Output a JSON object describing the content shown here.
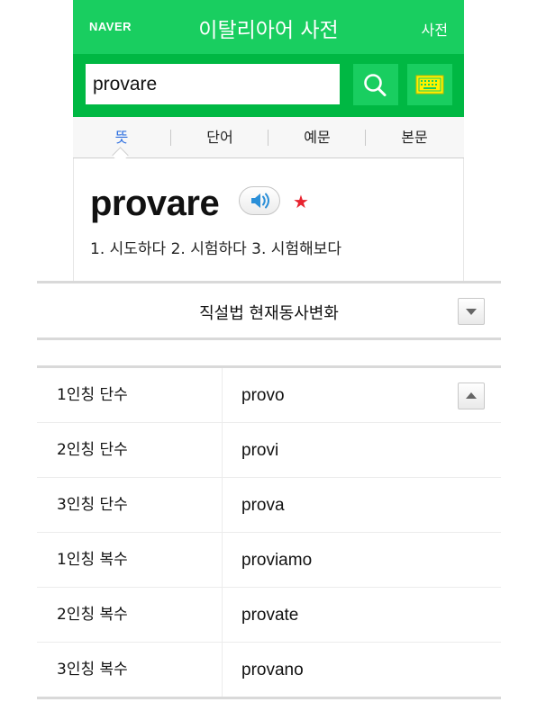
{
  "header": {
    "logo": "NAVER",
    "title": "이탈리아어 사전",
    "link": "사전"
  },
  "search": {
    "value": "provare"
  },
  "icons": {
    "search": "search-icon",
    "keyboard": "keyboard-icon",
    "speaker": "speaker-icon",
    "star": "star-icon",
    "dropdown": "chevron-down-icon",
    "collapse": "chevron-up-icon"
  },
  "colors": {
    "header_green": "#19ce60",
    "search_green": "#00b843",
    "active_tab": "#2f70e0",
    "star_red": "#e8232f"
  },
  "tabs": [
    {
      "label": "뜻",
      "active": true
    },
    {
      "label": "단어"
    },
    {
      "label": "예문"
    },
    {
      "label": "본문"
    }
  ],
  "entry": {
    "word": "provare",
    "meanings": "1. 시도하다  2. 시험하다  3. 시험해보다"
  },
  "conjugation": {
    "title": "직설법 현재동사변화",
    "rows": [
      {
        "label": "1인칭 단수",
        "value": "provo"
      },
      {
        "label": "2인칭 단수",
        "value": "provi"
      },
      {
        "label": "3인칭 단수",
        "value": "prova"
      },
      {
        "label": "1인칭 복수",
        "value": "proviamo"
      },
      {
        "label": "2인칭 복수",
        "value": "provate"
      },
      {
        "label": "3인칭 복수",
        "value": "provano"
      }
    ]
  }
}
